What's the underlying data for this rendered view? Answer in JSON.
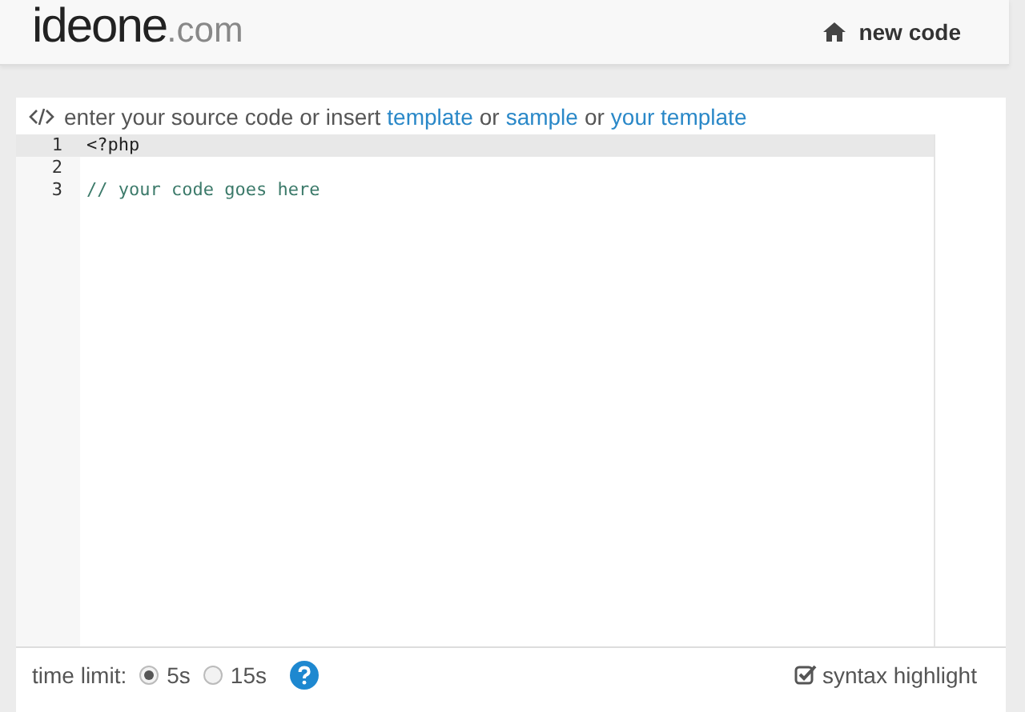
{
  "header": {
    "logo": "ideone",
    "logo_suffix": ".com",
    "nav": {
      "label": "new code"
    }
  },
  "prompt": {
    "parts": [
      {
        "kind": "text",
        "text": "enter your source code or insert"
      },
      {
        "kind": "link",
        "text": "template"
      },
      {
        "kind": "text",
        "text": "or"
      },
      {
        "kind": "link",
        "text": "sample"
      },
      {
        "kind": "text",
        "text": "or"
      },
      {
        "kind": "link",
        "text": "your template"
      }
    ]
  },
  "editor": {
    "lines": [
      {
        "number": "1",
        "code": "<?php",
        "kind": "code",
        "selected": true
      },
      {
        "number": "2",
        "selected": false
      },
      {
        "number": "3",
        "code": "// your code goes here",
        "kind": "comment",
        "selected": false
      }
    ]
  },
  "options": {
    "time_limit_label": "time limit:",
    "time_limits": [
      {
        "label": "5s",
        "selected": true
      },
      {
        "label": "15s",
        "selected": false
      }
    ],
    "syntax_highlight": {
      "label": "syntax highlight",
      "checked": true
    }
  }
}
